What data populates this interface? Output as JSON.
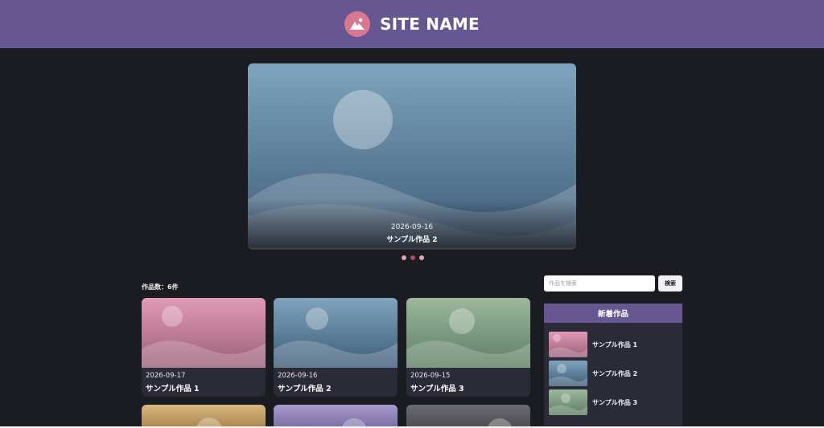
{
  "header": {
    "site_name": "SITE NAME",
    "logo_icon": "mountain-sun-icon"
  },
  "hero": {
    "date": "2026-09-16",
    "title": "サンプル作品 2",
    "colors": {
      "top": "#7fa4bd",
      "bottom": "#3d5b78"
    }
  },
  "carousel": {
    "dot_count": 3,
    "active_index": 1
  },
  "works": {
    "count_label": "作品数：6件",
    "items": [
      {
        "date": "2026-09-17",
        "title": "サンプル作品 1",
        "color_top": "#e29ab4",
        "color_bottom": "#9a5f7a"
      },
      {
        "date": "2026-09-16",
        "title": "サンプル作品 2",
        "color_top": "#7fa4bd",
        "color_bottom": "#3d5b78"
      },
      {
        "date": "2026-09-15",
        "title": "サンプル作品 3",
        "color_top": "#9bb89c",
        "color_bottom": "#5e7d63"
      },
      {
        "color_top": "#d8b97f",
        "color_bottom": "#a9844c"
      },
      {
        "color_top": "#a99bcb",
        "color_bottom": "#7a6ba1"
      },
      {
        "color_top": "#6a6a72",
        "color_bottom": "#4a4a50"
      }
    ]
  },
  "search": {
    "placeholder": "作品を検索",
    "button_label": "検索"
  },
  "sidebar": {
    "title": "新着作品",
    "items": [
      {
        "label": "サンプル作品 1",
        "color_top": "#e29ab4",
        "color_bottom": "#9a5f7a"
      },
      {
        "label": "サンプル作品 2",
        "color_top": "#7fa4bd",
        "color_bottom": "#3d5b78"
      },
      {
        "label": "サンプル作品 3",
        "color_top": "#9bb89c",
        "color_bottom": "#5e7d63"
      }
    ]
  },
  "colors": {
    "header_bg": "#665792",
    "page_bg": "#1b1b22",
    "card_bg": "#2a2b36",
    "accent_pink": "#d9778f"
  }
}
